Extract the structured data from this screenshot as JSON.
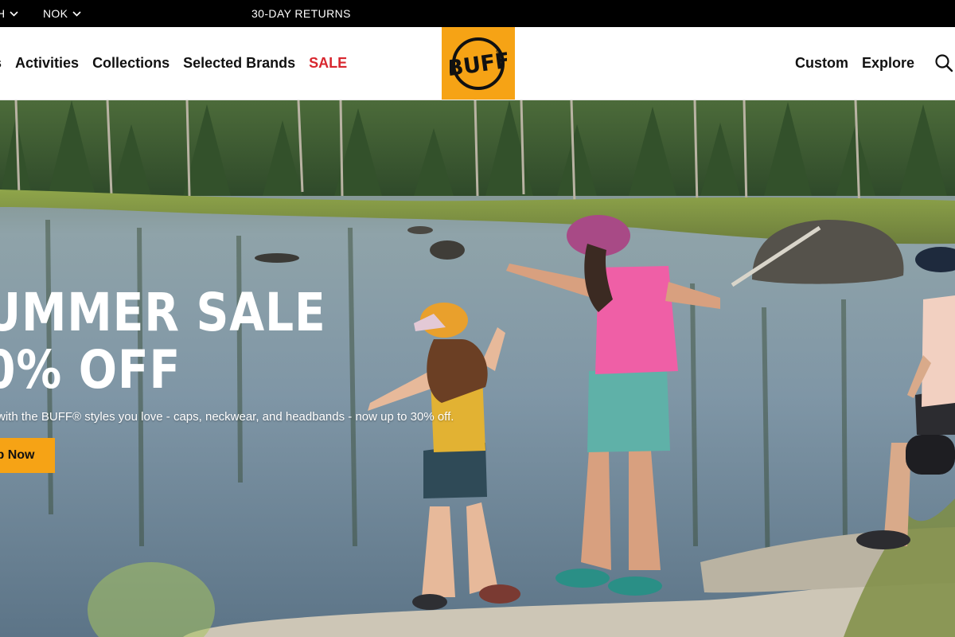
{
  "topbar": {
    "language_label": "H",
    "currency_label": "NOK",
    "promo_text": "30-DAY RETURNS"
  },
  "header": {
    "left_nav": [
      "Activities",
      "Collections",
      "Selected Brands",
      "SALE"
    ],
    "right_nav": [
      "Custom",
      "Explore"
    ],
    "logo_text": "BUFF",
    "icons": {
      "search": "search-icon",
      "chevron": "chevron-down-icon"
    }
  },
  "hero": {
    "title_line1": "UMMER SALE",
    "title_line2": "0% OFF",
    "subtitle": "with the BUFF® styles you love - caps, neckwear, and headbands - now up to 30% off.",
    "cta_label": "p Now"
  },
  "colors": {
    "brand_orange": "#f6a315",
    "sale_red": "#d8262e",
    "topbar_bg": "#000000",
    "text_dark": "#111111"
  }
}
